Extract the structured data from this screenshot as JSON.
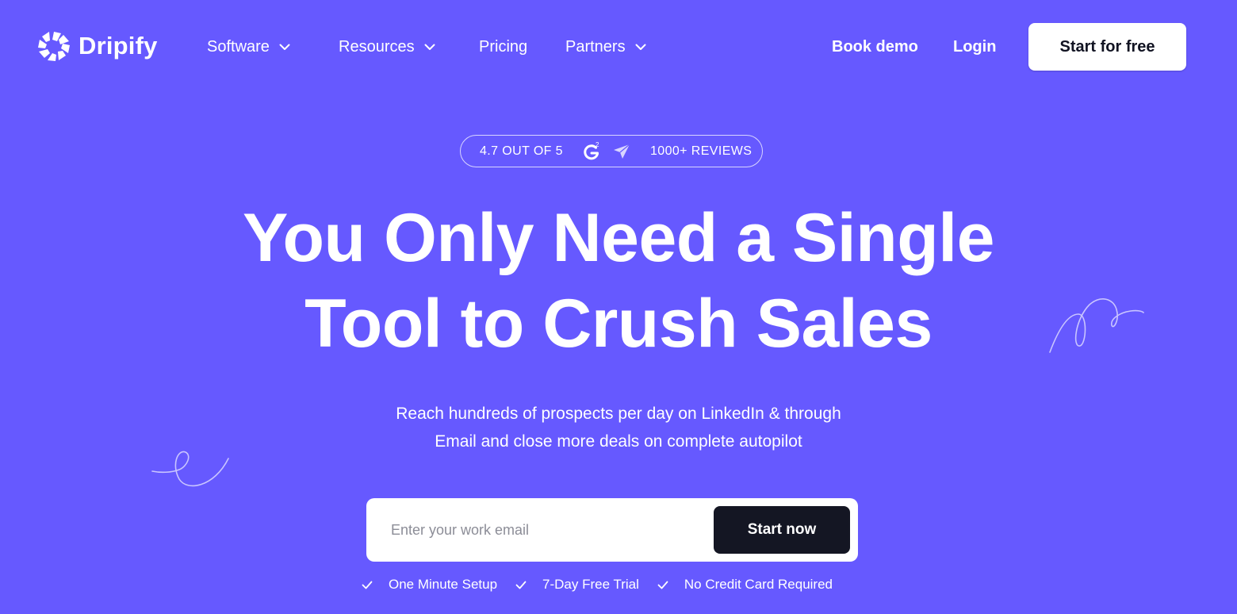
{
  "nav": {
    "brand": "Dripify",
    "logo_icon": "dripify-aperture-logo-icon",
    "items": [
      {
        "label": "Software",
        "has_dropdown": true
      },
      {
        "label": "Resources",
        "has_dropdown": true
      },
      {
        "label": "Pricing",
        "has_dropdown": false
      },
      {
        "label": "Partners",
        "has_dropdown": true
      }
    ],
    "book_demo": "Book demo",
    "login": "Login",
    "cta": "Start for free"
  },
  "rating": {
    "score_text": "4.7 OUT OF 5",
    "reviews_text": "1000+ REVIEWS",
    "icons": [
      "g2-logo-icon",
      "send-arrow-icon"
    ]
  },
  "hero": {
    "headline_line1": "You Only Need a Single",
    "headline_line2": "Tool to Crush Sales",
    "subtext_line1": "Reach hundreds of prospects per day on LinkedIn & through",
    "subtext_line2": "Email and close more deals on complete autopilot"
  },
  "form": {
    "email_placeholder": "Enter your work email",
    "email_value": "",
    "submit_label": "Start now"
  },
  "features": [
    {
      "label": "One Minute Setup"
    },
    {
      "label": "7-Day Free Trial"
    },
    {
      "label": "No Credit Card Required"
    }
  ],
  "colors": {
    "background": "#6659ff",
    "text": "#ffffff",
    "dark_button": "#141623",
    "light_button": "#ffffff"
  }
}
